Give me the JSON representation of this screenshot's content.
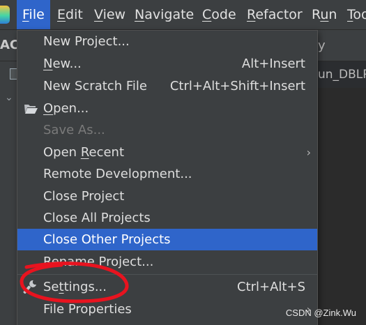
{
  "menubar": {
    "items": [
      {
        "pre": "",
        "mn": "F",
        "post": "ile",
        "active": true
      },
      {
        "pre": "",
        "mn": "E",
        "post": "dit"
      },
      {
        "pre": "",
        "mn": "V",
        "post": "iew"
      },
      {
        "pre": "",
        "mn": "N",
        "post": "avigate"
      },
      {
        "pre": "",
        "mn": "C",
        "post": "ode"
      },
      {
        "pre": "",
        "mn": "R",
        "post": "efactor"
      },
      {
        "pre": "R",
        "mn": "u",
        "post": "n"
      },
      {
        "pre": "",
        "mn": "T",
        "post": "oo"
      }
    ]
  },
  "background": {
    "toolbar_left_fragment": "AC",
    "toolbar_right_fragment": "y",
    "tab_fragment": "un_DBLP"
  },
  "file_menu": {
    "items": [
      {
        "pre": "New Project...",
        "mn": "",
        "post": "",
        "shortcut": ""
      },
      {
        "pre": "",
        "mn": "N",
        "post": "ew...",
        "shortcut": "Alt+Insert"
      },
      {
        "pre": "New Scratch File",
        "mn": "",
        "post": "",
        "shortcut": "Ctrl+Alt+Shift+Insert"
      },
      {
        "pre": "",
        "mn": "O",
        "post": "pen...",
        "shortcut": "",
        "icon": "folder-open-icon"
      },
      {
        "pre": "Save As...",
        "mn": "",
        "post": "",
        "shortcut": "",
        "disabled": true
      },
      {
        "pre": "Open ",
        "mn": "R",
        "post": "ecent",
        "shortcut": "",
        "submenu": true
      },
      {
        "pre": "Remote Development...",
        "mn": "",
        "post": "",
        "shortcut": ""
      },
      {
        "pre": "Close Project",
        "mn": "",
        "post": "",
        "shortcut": ""
      },
      {
        "pre": "Close All Projects",
        "mn": "",
        "post": "",
        "shortcut": ""
      },
      {
        "pre": "Close Other Projects",
        "mn": "",
        "post": "",
        "shortcut": "",
        "highlighted": true
      },
      {
        "pre": "Rename Project...",
        "mn": "",
        "post": "",
        "shortcut": ""
      },
      {
        "pre": "Se",
        "mn": "t",
        "post": "tings...",
        "shortcut": "Ctrl+Alt+S",
        "icon": "wrench-icon"
      },
      {
        "pre": "File Properties",
        "mn": "",
        "post": "",
        "shortcut": "",
        "submenu": true
      }
    ]
  },
  "colors": {
    "highlight": "#2f65ca",
    "annotation": "#e8131f"
  },
  "watermark": "CSDN @Zink.Wu"
}
